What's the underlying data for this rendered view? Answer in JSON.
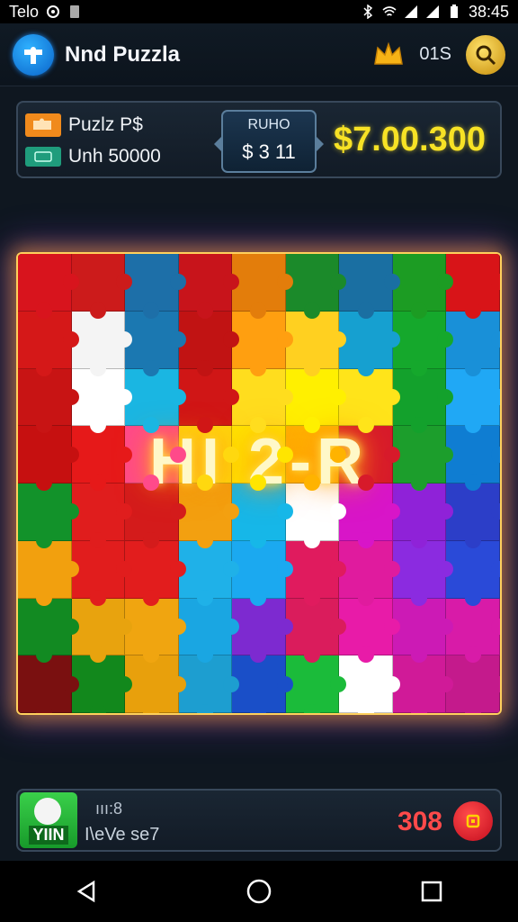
{
  "status_bar": {
    "carrier": "Telo",
    "time": "38:45",
    "icons": [
      "settings-icon",
      "sim-icon",
      "bluetooth-icon",
      "wifi-icon",
      "signal-icon",
      "signal-icon",
      "battery-icon"
    ]
  },
  "header": {
    "title": "Nnd Puzzla",
    "logo_icon": "puzzle-logo-icon",
    "crown_icon": "crown-icon",
    "count": "01S",
    "search_icon": "search-coin-icon"
  },
  "info": {
    "row1_label": "Puzlz P$",
    "row2_label": "Unh 50000",
    "round_label": "RUHO",
    "round_value": "$ 3 11",
    "money": "$7.00.300"
  },
  "board": {
    "overlay_text": "HI 2-R",
    "colors": [
      "#d8141d",
      "#cc1b1b",
      "#1d6fa8",
      "#c8141b",
      "#e37d0b",
      "#1b8a2a",
      "#1a6fa2",
      "#1c9c23",
      "#d81418",
      "#d51818",
      "#f4f4f4",
      "#1b78b1",
      "#c11313",
      "#ff9f10",
      "#ffd020",
      "#16a0d0",
      "#15a82c",
      "#1990d8",
      "#c81414",
      "#ffffff",
      "#1ab6e2",
      "#d01616",
      "#ffdd1e",
      "#fff000",
      "#ffe41a",
      "#13a12c",
      "#20a8f5",
      "#c61010",
      "#e61919",
      "#ff4a8a",
      "#ffd80f",
      "#ffe500",
      "#ffb300",
      "#d71a2a",
      "#1c9e2c",
      "#0f7dd2",
      "#12922a",
      "#e01d1d",
      "#d41b1b",
      "#f3a010",
      "#16b7e8",
      "#ffffff",
      "#d815c8",
      "#8f22d8",
      "#2c3ec8",
      "#f2a00e",
      "#e11d1d",
      "#e21d1d",
      "#1fb1e8",
      "#1ba9f0",
      "#e01b5e",
      "#e01b9e",
      "#8b2be0",
      "#2a4ad8",
      "#128a22",
      "#e8a30e",
      "#f0a510",
      "#1aa6e2",
      "#7d2ad0",
      "#da1c5c",
      "#e81ba8",
      "#cc1ab5",
      "#d81ba8",
      "#7a1010",
      "#12881c",
      "#e8a00c",
      "#1d9ed0",
      "#1a4fc8",
      "#1bbb3a",
      "#ffffff",
      "#d01a98",
      "#c41a8c"
    ]
  },
  "player": {
    "badge_text": "YIIN",
    "line1": "ııı:8",
    "line2": "I\\eVe se7",
    "score": "308"
  },
  "nav": {
    "back_icon": "back-icon",
    "home_icon": "home-icon",
    "recents_icon": "recents-icon"
  }
}
